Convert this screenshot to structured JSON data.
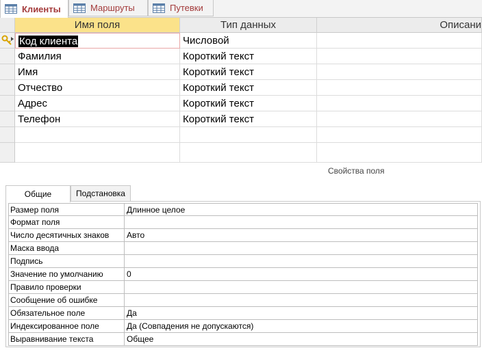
{
  "tabs": [
    {
      "label": "Клиенты",
      "active": true,
      "icon": "table-icon"
    },
    {
      "label": "Маршруты",
      "active": false,
      "icon": "table-icon"
    },
    {
      "label": "Путевки",
      "active": false,
      "icon": "table-icon"
    }
  ],
  "grid": {
    "headers": [
      "Имя поля",
      "Тип данных",
      "Описани"
    ],
    "rows": [
      {
        "name": "Код клиента",
        "type": "Числовой",
        "description": "",
        "primary_key": true
      },
      {
        "name": "Фамилия",
        "type": "Короткий текст",
        "description": ""
      },
      {
        "name": "Имя",
        "type": "Короткий текст",
        "description": ""
      },
      {
        "name": "Отчество",
        "type": "Короткий текст",
        "description": ""
      },
      {
        "name": "Адрес",
        "type": "Короткий текст",
        "description": ""
      },
      {
        "name": "Телефон",
        "type": "Короткий текст",
        "description": ""
      },
      {
        "name": "",
        "type": "",
        "description": ""
      },
      {
        "name": "",
        "type": "",
        "description": ""
      }
    ]
  },
  "properties": {
    "title": "Свойства поля",
    "tabs": [
      "Общие",
      "Подстановка"
    ],
    "rows": [
      {
        "label": "Размер поля",
        "value": "Длинное целое"
      },
      {
        "label": "Формат поля",
        "value": ""
      },
      {
        "label": "Число десятичных знаков",
        "value": "Авто"
      },
      {
        "label": "Маска ввода",
        "value": ""
      },
      {
        "label": "Подпись",
        "value": ""
      },
      {
        "label": "Значение по умолчанию",
        "value": "0"
      },
      {
        "label": "Правило проверки",
        "value": ""
      },
      {
        "label": "Сообщение об ошибке",
        "value": ""
      },
      {
        "label": "Обязательное поле",
        "value": "Да"
      },
      {
        "label": "Индексированное поле",
        "value": "Да (Совпадения не допускаются)"
      },
      {
        "label": "Выравнивание текста",
        "value": "Общее"
      }
    ]
  },
  "colors": {
    "tab_text": "#a33a3a",
    "selected_header": "#fbe28a",
    "selection": "#000000",
    "key_icon": "#d9a400"
  }
}
